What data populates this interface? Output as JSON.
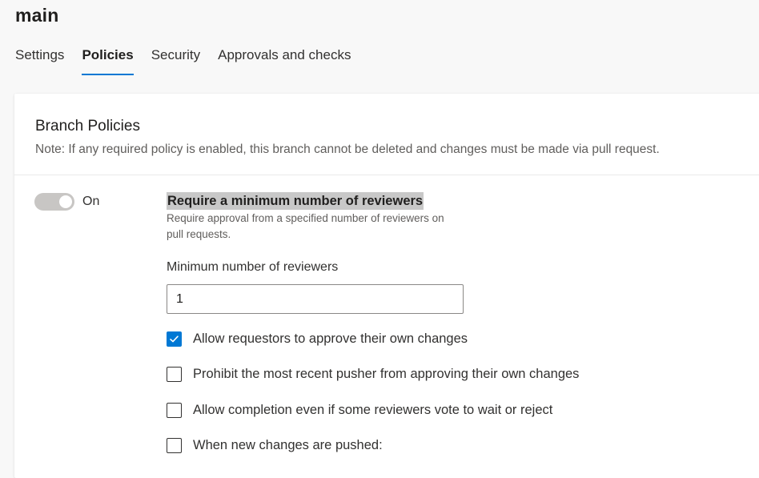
{
  "page": {
    "title": "main"
  },
  "tabs": [
    {
      "label": "Settings",
      "active": false
    },
    {
      "label": "Policies",
      "active": true
    },
    {
      "label": "Security",
      "active": false
    },
    {
      "label": "Approvals and checks",
      "active": false
    }
  ],
  "card": {
    "title": "Branch Policies",
    "note": "Note: If any required policy is enabled, this branch cannot be deleted and changes must be made via pull request."
  },
  "policy": {
    "toggle_label": "On",
    "toggle_on": true,
    "title": "Require a minimum number of reviewers",
    "description": "Require approval from a specified number of reviewers on pull requests.",
    "min_reviewers_label": "Minimum number of reviewers",
    "min_reviewers_value": "1",
    "options": [
      {
        "label": "Allow requestors to approve their own changes",
        "checked": true
      },
      {
        "label": "Prohibit the most recent pusher from approving their own changes",
        "checked": false
      },
      {
        "label": "Allow completion even if some reviewers vote to wait or reject",
        "checked": false
      },
      {
        "label": "When new changes are pushed:",
        "checked": false
      }
    ]
  },
  "colors": {
    "accent": "#0078d4",
    "toggle_track": "#c8c6c4",
    "highlight": "#c8c8c8"
  },
  "icons": {
    "checkmark": "checkmark-icon"
  }
}
